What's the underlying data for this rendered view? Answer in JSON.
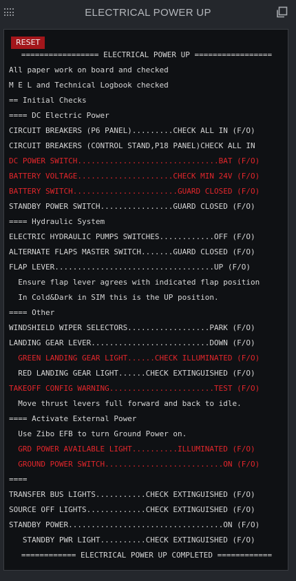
{
  "window": {
    "title": "ELECTRICAL POWER UP",
    "reset_label": "RESET"
  },
  "lines": [
    {
      "text": "================= ELECTRICAL POWER UP =================",
      "style": "center"
    },
    {
      "text": "All paper work on board and checked",
      "style": "normal"
    },
    {
      "text": "M E L and Technical Logbook checked",
      "style": "normal"
    },
    {
      "text": "== Initial Checks",
      "style": "normal"
    },
    {
      "text": "==== DC Electric Power",
      "style": "normal"
    },
    {
      "text": "CIRCUIT BREAKERS (P6 PANEL).........CHECK ALL IN (F/O)",
      "style": "normal"
    },
    {
      "text": "CIRCUIT BREAKERS (CONTROL STAND,P18 PANEL)CHECK ALL IN",
      "style": "normal"
    },
    {
      "text": "DC POWER SWITCH...............................BAT (F/O)",
      "style": "red"
    },
    {
      "text": "BATTERY VOLTAGE.....................CHECK MIN 24V (F/O)",
      "style": "red"
    },
    {
      "text": "BATTERY SWITCH.......................GUARD CLOSED (F/O)",
      "style": "red"
    },
    {
      "text": "STANDBY POWER SWITCH................GUARD CLOSED (F/O)",
      "style": "normal"
    },
    {
      "text": "==== Hydraulic System",
      "style": "normal"
    },
    {
      "text": "ELECTRIC HYDRAULIC PUMPS SWITCHES............OFF (F/O)",
      "style": "normal"
    },
    {
      "text": "ALTERNATE FLAPS MASTER SWITCH.......GUARD CLOSED (F/O)",
      "style": "normal"
    },
    {
      "text": "FLAP LEVER...................................UP (F/O)",
      "style": "normal"
    },
    {
      "text": "  Ensure flap lever agrees with indicated flap position",
      "style": "normal"
    },
    {
      "text": "  In Cold&Dark in SIM this is the UP position.",
      "style": "normal"
    },
    {
      "text": "==== Other",
      "style": "normal"
    },
    {
      "text": "WINDSHIELD WIPER SELECTORS..................PARK (F/O)",
      "style": "normal"
    },
    {
      "text": "LANDING GEAR LEVER..........................DOWN (F/O)",
      "style": "normal"
    },
    {
      "text": "  GREEN LANDING GEAR LIGHT......CHECK ILLUMINATED (F/O)",
      "style": "red"
    },
    {
      "text": "  RED LANDING GEAR LIGHT......CHECK EXTINGUISHED (F/O)",
      "style": "normal"
    },
    {
      "text": "TAKEOFF CONFIG WARNING.......................TEST (F/O)",
      "style": "red"
    },
    {
      "text": "  Move thrust levers full forward and back to idle.",
      "style": "normal"
    },
    {
      "text": "==== Activate External Power",
      "style": "normal"
    },
    {
      "text": "  Use Zibo EFB to turn Ground Power on.",
      "style": "normal"
    },
    {
      "text": "  GRD POWER AVAILABLE LIGHT..........ILLUMINATED (F/O)",
      "style": "red"
    },
    {
      "text": "  GROUND POWER SWITCH..........................ON (F/O)",
      "style": "red"
    },
    {
      "text": "====",
      "style": "normal"
    },
    {
      "text": "TRANSFER BUS LIGHTS...........CHECK EXTINGUISHED (F/O)",
      "style": "normal"
    },
    {
      "text": "SOURCE OFF LIGHTS.............CHECK EXTINGUISHED (F/O)",
      "style": "normal"
    },
    {
      "text": "STANDBY POWER..................................ON (F/O)",
      "style": "normal"
    },
    {
      "text": "   STANDBY PWR LIGHT..........CHECK EXTINGUISHED (F/O)",
      "style": "normal"
    },
    {
      "text": "============ ELECTRICAL POWER UP COMPLETED ============",
      "style": "center"
    }
  ],
  "icons": {
    "drag": "grip-dots-icon",
    "popout": "popout-window-icon"
  },
  "colors": {
    "alert": "#e3262b",
    "reset_button": "#a3161b",
    "text": "#d6d6d6",
    "panel": "#0f1114"
  }
}
